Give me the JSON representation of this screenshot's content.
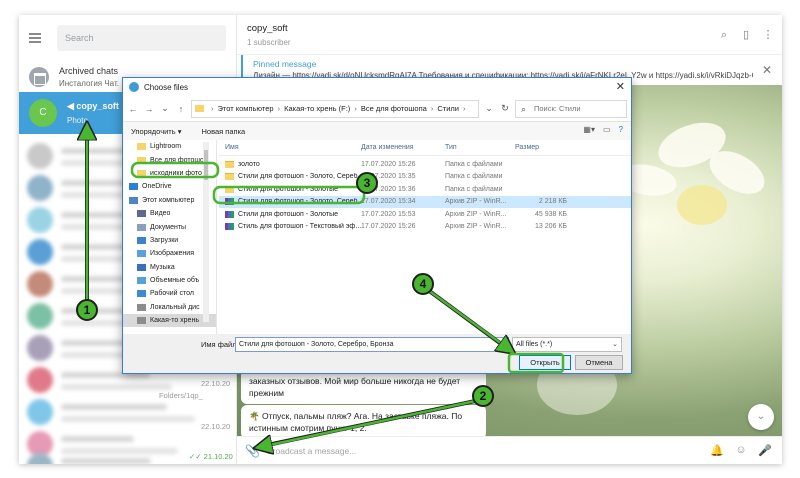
{
  "colors": {
    "accent": "#419fd9",
    "annotation_green": "#49b530",
    "selection": "#cce8ff"
  },
  "tg": {
    "search_placeholder": "Search",
    "archived_title": "Archived chats",
    "archived_sub": "Инсталогия Чат. ",
    "active_chat": {
      "avatar_letter": "C",
      "name": "copy_soft",
      "sub": "Photo"
    },
    "list_dates": [
      "22.10.20",
      "22.10.20",
      "21.10.20"
    ],
    "list_snippet": "Folders/1qp_",
    "channel": {
      "title": "copy_soft",
      "subtitle": "1 subscriber"
    },
    "pinned": {
      "title": "Pinned message",
      "text": "Дизайн — https://yadi.sk/d/oNUcksmdRqAI7A Требования и спецификации: https://yadi.sk/i/aFrNKLr2eL Y2w и https://yadi.sk/i/vRkiDJqzb-ColA…"
    },
    "msg1": "заказных отзывов. Мой мир больше никогда не будет прежним",
    "msg2": "Отпуск, пальмы пляж? Ага. На заставке пляжа. По истинным смотрим пункт 1, 2.",
    "input_placeholder": "Broadcast a message..."
  },
  "dialog": {
    "title": "Choose files",
    "path": [
      "Этот компьютер",
      "Какая-то хрень (F:)",
      "Все для фотошопа",
      "Стили"
    ],
    "search_placeholder": "Поиск: Стили",
    "organize": "Упорядочить ▾",
    "new_folder": "Новая папка",
    "nav": [
      {
        "label": "Lightroom",
        "kind": "folder",
        "indent": true
      },
      {
        "label": "Все для фотошо",
        "kind": "folder",
        "indent": true
      },
      {
        "label": "исходники фото",
        "kind": "folder",
        "indent": true
      },
      {
        "label": "OneDrive",
        "kind": "cloud",
        "indent": false
      },
      {
        "label": "Этот компьютер",
        "kind": "pc",
        "indent": false
      },
      {
        "label": "Видео",
        "kind": "video",
        "indent": true
      },
      {
        "label": "Документы",
        "kind": "docs",
        "indent": true
      },
      {
        "label": "Загрузки",
        "kind": "down",
        "indent": true
      },
      {
        "label": "Изображения",
        "kind": "img",
        "indent": true
      },
      {
        "label": "Музыка",
        "kind": "music",
        "indent": true
      },
      {
        "label": "Объемные объ",
        "kind": "3d",
        "indent": true
      },
      {
        "label": "Рабочий стол",
        "kind": "desk",
        "indent": true
      },
      {
        "label": "Локальный дис",
        "kind": "disk",
        "indent": true
      },
      {
        "label": "Какая-то хрень",
        "kind": "disk",
        "indent": true
      }
    ],
    "columns": [
      "Имя",
      "Дата изменения",
      "Тип",
      "Размер"
    ],
    "files": [
      {
        "name": "золото",
        "date": "17.07.2020 15:26",
        "type": "Папка с файлами",
        "size": "",
        "kind": "folder"
      },
      {
        "name": "Стили для фотошоп - Золото, Серебро, ...",
        "date": "17.07.2020 15:35",
        "type": "Папка с файлами",
        "size": "",
        "kind": "folder"
      },
      {
        "name": "Стили для фотошоп - Золотые",
        "date": "17.07.2020 15:36",
        "type": "Папка с файлами",
        "size": "",
        "kind": "folder"
      },
      {
        "name": "Стили для фотошоп - Золото, Серебро, ...",
        "date": "17.07.2020 15:34",
        "type": "Архив ZIP - WinR...",
        "size": "2 218 КБ",
        "kind": "zip"
      },
      {
        "name": "Стили для фотошоп - Золотые",
        "date": "17.07.2020 15:53",
        "type": "Архив ZIP - WinR...",
        "size": "45 938 КБ",
        "kind": "zip"
      },
      {
        "name": "Стиль для фотошоп - Текстовый эфф...",
        "date": "17.07.2020 15:26",
        "type": "Архив ZIP - WinR...",
        "size": "13 206 КБ",
        "kind": "zip"
      }
    ],
    "filename_label": "Имя файла:",
    "filename_value": "Стили для фотошоп - Золото, Серебро, Бронза",
    "filetype": "All files (*.*)",
    "open": "Открыть",
    "cancel": "Отмена"
  },
  "annotations": [
    "1",
    "2",
    "3",
    "4"
  ]
}
